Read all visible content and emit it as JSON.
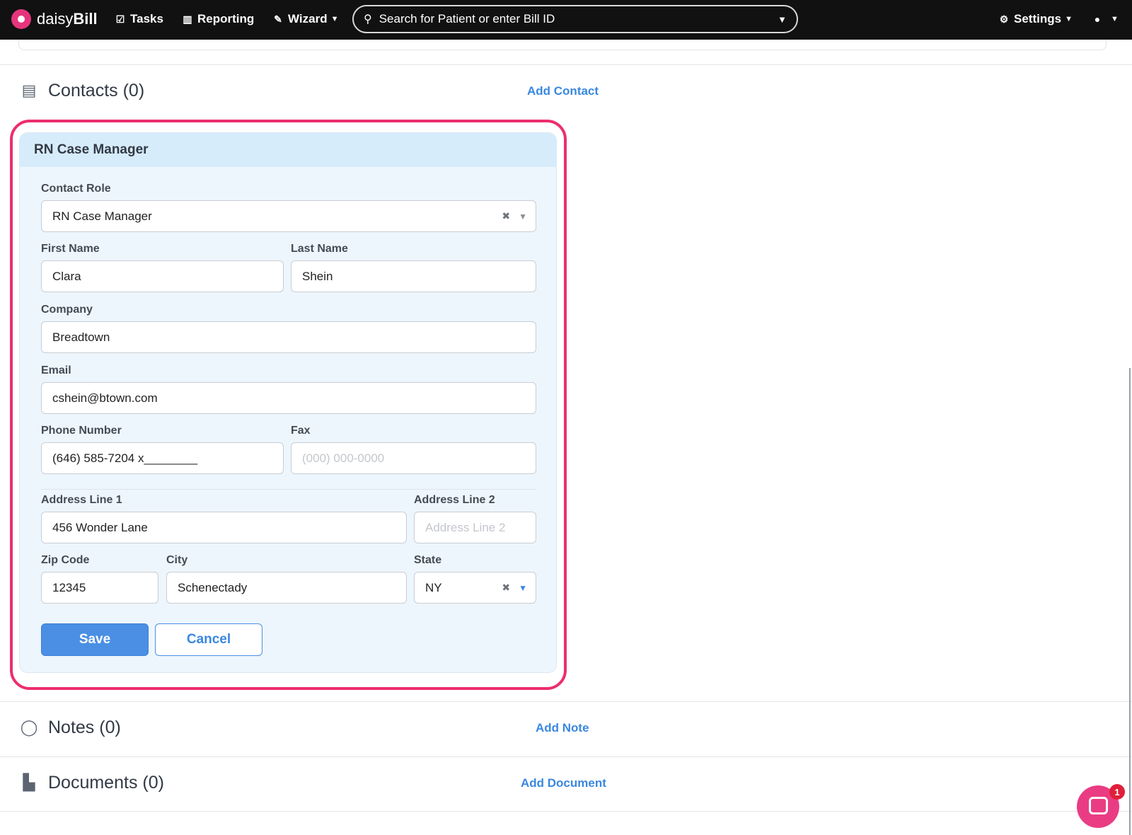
{
  "app": {
    "logo_text_light": "daisy",
    "logo_text_bold": "Bill"
  },
  "nav": {
    "tasks": "Tasks",
    "reporting": "Reporting",
    "wizard": "Wizard",
    "search_placeholder": "Search for Patient or enter Bill ID",
    "settings": "Settings"
  },
  "contacts": {
    "title": "Contacts (0)",
    "add_label": "Add Contact",
    "card": {
      "header": "RN Case Manager",
      "contact_role_label": "Contact Role",
      "contact_role_value": "RN Case Manager",
      "first_name_label": "First Name",
      "first_name_value": "Clara",
      "last_name_label": "Last Name",
      "last_name_value": "Shein",
      "company_label": "Company",
      "company_value": "Breadtown",
      "email_label": "Email",
      "email_value": "cshein@btown.com",
      "phone_label": "Phone Number",
      "phone_value": "(646) 585-7204 x________",
      "fax_label": "Fax",
      "fax_placeholder": "(000) 000-0000",
      "address1_label": "Address Line 1",
      "address1_value": "456 Wonder Lane",
      "address2_label": "Address Line 2",
      "address2_placeholder": "Address Line 2",
      "zip_label": "Zip Code",
      "zip_value": "12345",
      "city_label": "City",
      "city_value": "Schenectady",
      "state_label": "State",
      "state_value": "NY",
      "save_label": "Save",
      "cancel_label": "Cancel"
    }
  },
  "notes": {
    "title": "Notes (0)",
    "add_label": "Add Note"
  },
  "documents": {
    "title": "Documents (0)",
    "add_label": "Add Document"
  },
  "chat": {
    "badge_count": "1"
  },
  "colors": {
    "accent": "#3a88e0",
    "highlight": "#ec2e6d",
    "brand": "#e5357c"
  },
  "icons": {
    "contacts": "contact-card-icon",
    "notes": "speech-bubble-icon",
    "documents": "pdf-document-icon",
    "search": "search-icon",
    "settings": "gear-icon",
    "account": "user-circle-icon"
  }
}
